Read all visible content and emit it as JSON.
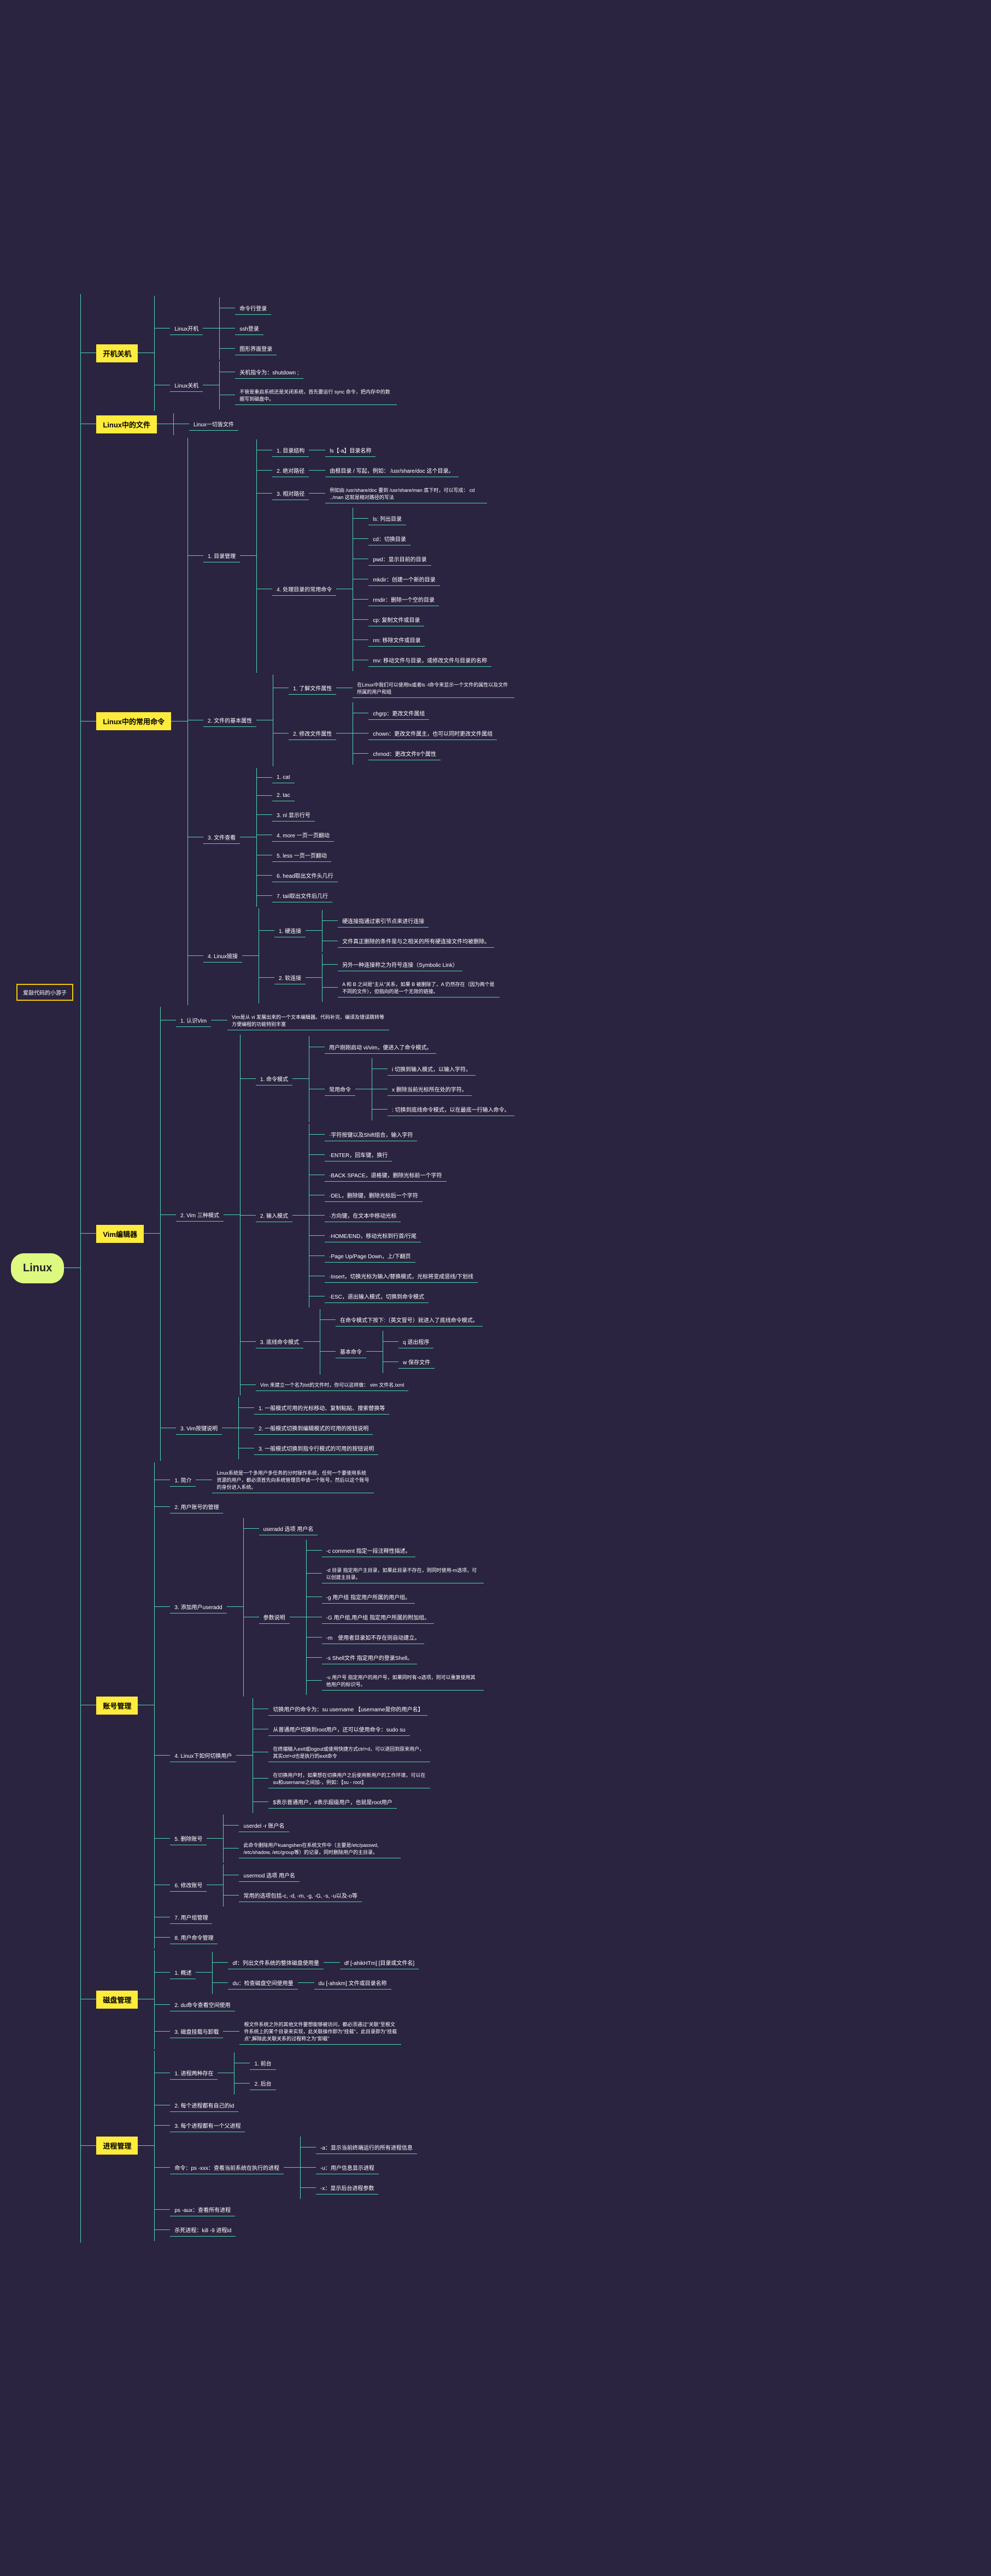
{
  "root": "Linux",
  "author": "爱敲代码的小游子",
  "sections": [
    {
      "t": "开机关机",
      "ch": [
        {
          "t": "Linux开机",
          "ch": [
            {
              "t": "命令行登录"
            },
            {
              "t": "ssh登录"
            },
            {
              "t": "图形界面登录"
            }
          ]
        },
        {
          "t": "Linux关机",
          "ch": [
            {
              "t": "关机指令为：shutdown ;"
            },
            {
              "t": "不管是重启系统还是关闭系统，首先要运行 sync 命令，把内存中的数据写到磁盘中。"
            }
          ]
        }
      ]
    },
    {
      "t": "Linux中的文件",
      "ch": [
        {
          "t": "Linux一切皆文件"
        }
      ]
    },
    {
      "t": "Linux中的常用命令",
      "ch": [
        {
          "n": "1.",
          "t": "目录管理",
          "ch": [
            {
              "n": "1.",
              "t": "目录结构",
              "d": "ls【-a】目录名称"
            },
            {
              "n": "2.",
              "t": "绝对路径",
              "d": "由根目录 / 写起，例如： /usr/share/doc 这个目录。"
            },
            {
              "n": "3.",
              "t": "相对路径",
              "d": "例如由 /usr/share/doc 要到 /usr/share/man 底下时，可以写成： cd ../man 这就是相对路径的写法"
            },
            {
              "n": "4.",
              "t": "处理目录的常用命令",
              "ch": [
                {
                  "t": "ls: 列出目录"
                },
                {
                  "t": "cd：切换目录"
                },
                {
                  "t": "pwd：显示目前的目录"
                },
                {
                  "t": "mkdir：创建一个新的目录"
                },
                {
                  "t": "rmdir：删除一个空的目录"
                },
                {
                  "t": "cp: 复制文件或目录"
                },
                {
                  "t": "rm: 移除文件或目录"
                },
                {
                  "t": "mv: 移动文件与目录，或修改文件与目录的名称"
                }
              ]
            }
          ]
        },
        {
          "n": "2.",
          "t": "文件的基本属性",
          "ch": [
            {
              "n": "1.",
              "t": "了解文件属性",
              "d": "在Linux中我们可以使用ls或者ls -l命令来显示一个文件的属性以及文件所属的用户和组"
            },
            {
              "n": "2.",
              "t": "修改文件属性",
              "ch": [
                {
                  "t": "chgrp：更改文件属组"
                },
                {
                  "t": "chown：更改文件属主，也可以同时更改文件属组"
                },
                {
                  "t": "chmod：更改文件9个属性"
                }
              ]
            }
          ]
        },
        {
          "n": "3.",
          "t": "文件查看",
          "ch": [
            {
              "n": "1.",
              "t": "cat"
            },
            {
              "n": "2.",
              "t": "tac"
            },
            {
              "n": "3.",
              "t": "nl 显示行号"
            },
            {
              "n": "4.",
              "t": "more 一页一页翻动"
            },
            {
              "n": "5.",
              "t": "less 一页一页翻动"
            },
            {
              "n": "6.",
              "t": "head取出文件头几行"
            },
            {
              "n": "7.",
              "t": "tail取出文件后几行"
            }
          ]
        },
        {
          "n": "4.",
          "t": "Linux链接",
          "ch": [
            {
              "n": "1.",
              "t": "硬连接",
              "ch": [
                {
                  "t": "硬连接指通过索引节点来进行连接"
                },
                {
                  "t": "文件真正删除的条件是与之相关的所有硬连接文件均被删除。"
                }
              ]
            },
            {
              "n": "2.",
              "t": "软连接",
              "ch": [
                {
                  "t": "另外一种连接称之为符号连接（Symbolic Link）"
                },
                {
                  "t": "A 和 B 之间是\"主从\"关系，如果 B 被删除了，A 仍然存在（因为两个是不同的文件），但指向的是一个无效的链接。"
                }
              ]
            }
          ]
        }
      ]
    },
    {
      "t": "Vim编辑器",
      "ch": [
        {
          "n": "1.",
          "t": "认识Vim",
          "d": "Vim是从 vi 发展出来的一个文本编辑器。代码补完、编译及错误跳转等方便编程的功能特别丰富"
        },
        {
          "n": "2.",
          "t": "Vim 三种模式",
          "ch": [
            {
              "n": "1.",
              "t": "命令模式",
              "ch": [
                {
                  "t": "用户刚刚启动 vi/vim，便进入了命令模式。"
                },
                {
                  "t": "常用命令",
                  "ch": [
                    {
                      "t": "i 切换到输入模式，以输入字符。"
                    },
                    {
                      "t": "x 删除当前光标所在处的字符。"
                    },
                    {
                      "t": ": 切换到底线命令模式，以在最底一行输入命令。"
                    }
                  ]
                }
              ]
            },
            {
              "n": "2.",
              "t": "输入模式",
              "ch": [
                {
                  "t": "·字符按键以及Shift组合，输入字符"
                },
                {
                  "t": "·ENTER，回车键，换行"
                },
                {
                  "t": "·BACK SPACE，退格键，删除光标前一个字符"
                },
                {
                  "t": "·DEL，删除键，删除光标后一个字符"
                },
                {
                  "t": "·方向键，在文本中移动光标"
                },
                {
                  "t": "·HOME/END，移动光标到行首/行尾"
                },
                {
                  "t": "·Page Up/Page Down，上/下翻页"
                },
                {
                  "t": "·Insert，切换光标为输入/替换模式，光标将变成竖线/下划线"
                },
                {
                  "t": "·ESC，退出输入模式，切换到命令模式"
                }
              ]
            },
            {
              "n": "3.",
              "t": "底线命令模式",
              "ch": [
                {
                  "t": "在命令模式下按下:（英文冒号）就进入了底线命令模式。"
                },
                {
                  "t": "基本命令",
                  "ch": [
                    {
                      "t": "q 退出程序"
                    },
                    {
                      "t": "w 保存文件"
                    }
                  ]
                }
              ]
            },
            {
              "t": "Vim 来建立一个名为txt的文件时，你可以这样做：   vim 文件名.txml"
            }
          ]
        },
        {
          "n": "3.",
          "t": "Vim按键说明",
          "ch": [
            {
              "n": "1.",
              "t": "一般模式可用的光标移动、复制粘贴、搜索替换等"
            },
            {
              "n": "2.",
              "t": "一般模式切换到编辑模式的可用的按钮说明"
            },
            {
              "n": "3.",
              "t": "一般模式切换到指令行模式的可用的按钮说明"
            }
          ]
        }
      ]
    },
    {
      "t": "账号管理",
      "ch": [
        {
          "n": "1.",
          "t": "简介",
          "d": "Linux系统是一个多用户多任务的分时操作系统，任何一个要使用系统资源的用户，都必须首先向系统管理员申请一个账号，然后以这个账号的身份进入系统。"
        },
        {
          "n": "2.",
          "t": "用户账号的管理"
        },
        {
          "n": "3.",
          "t": "添加用户useradd",
          "ch": [
            {
              "t": "useradd 选项 用户名"
            },
            {
              "t": "参数说明",
              "ch": [
                {
                  "t": "-c comment 指定一段注释性描述。"
                },
                {
                  "t": "-d 目录 指定用户主目录，如果此目录不存在，则同时使用-m选项，可以创建主目录。"
                },
                {
                  "t": "-g 用户组 指定用户所属的用户组。"
                },
                {
                  "t": "-G 用户组,用户组 指定用户所属的附加组。"
                },
                {
                  "t": "-m　使用者目录如不存在则自动建立。"
                },
                {
                  "t": "-s Shell文件 指定用户的登录Shell。"
                },
                {
                  "t": "-u 用户号 指定用户的用户号，如果同时有-o选项，则可以重复使用其他用户的标识号。"
                }
              ]
            }
          ]
        },
        {
          "n": "4.",
          "t": "Linux下如何切换用户",
          "ch": [
            {
              "t": "切换用户的命令为：su username 【username是你的用户名】"
            },
            {
              "t": "从普通用户切换到root用户，还可以使用命令：sudo su"
            },
            {
              "t": "在终端输入exit或logout或使用快捷方式ctrl+d，可以退回到原来用户，其实ctrl+d也是执行的exit命令"
            },
            {
              "t": "在切换用户时，如果想在切换用户之后使用新用户的工作环境，可以在su和username之间加-，例如：【su - root】"
            },
            {
              "t": "$表示普通用户，#表示超级用户，也就是root用户"
            }
          ]
        },
        {
          "n": "5.",
          "t": "删除账号",
          "ch": [
            {
              "t": "userdel -r 账户名"
            },
            {
              "t": "此命令删除用户kuangshen在系统文件中（主要是/etc/passwd, /etc/shadow, /etc/group等）的记录，同时删除用户的主目录。"
            }
          ]
        },
        {
          "n": "6.",
          "t": "修改账号",
          "ch": [
            {
              "t": "usermod 选项 用户名"
            },
            {
              "t": "常用的选项包括-c, -d, -m, -g, -G, -s, -u以及-o等"
            }
          ]
        },
        {
          "n": "7.",
          "t": "用户组管理"
        },
        {
          "n": "8.",
          "t": "用户命令管理"
        }
      ]
    },
    {
      "t": "磁盘管理",
      "ch": [
        {
          "n": "1.",
          "t": "概述",
          "ch": [
            {
              "t": "df：列出文件系统的整体磁盘使用量",
              "d": "df [-ahikHTm] [目录或文件名]"
            },
            {
              "t": "du：检查磁盘空间使用量",
              "d": "du [-ahskm] 文件或目录名称"
            }
          ]
        },
        {
          "n": "2.",
          "t": "du命令查看空间使用"
        },
        {
          "n": "3.",
          "t": "磁盘挂载与卸载",
          "d": "根文件系统之外的其他文件要想能够被访问，都必须通过\"关联\"至根文件系统上的某个目录来实现，此关联操作即为\"挂载\"，此目录即为\"挂载点\",解除此关联关系的过程称之为\"卸载\""
        }
      ]
    },
    {
      "t": "进程管理",
      "ch": [
        {
          "n": "1.",
          "t": "进程两种存在",
          "ch": [
            {
              "n": "1.",
              "t": "前台"
            },
            {
              "n": "2.",
              "t": "后台"
            }
          ]
        },
        {
          "n": "2.",
          "t": "每个进程都有自己的id"
        },
        {
          "n": "3.",
          "t": "每个进程都有一个父进程"
        },
        {
          "t": "命令：ps -xxx：查看当前系统在执行的进程",
          "ch": [
            {
              "t": "-a：显示当前终端运行的所有进程信息"
            },
            {
              "t": "-u：用户信息显示进程"
            },
            {
              "t": "-x：显示后台进程参数"
            }
          ]
        },
        {
          "t": "ps -aux：查看所有进程"
        },
        {
          "t": "杀死进程：kill -9 进程id"
        }
      ]
    }
  ]
}
